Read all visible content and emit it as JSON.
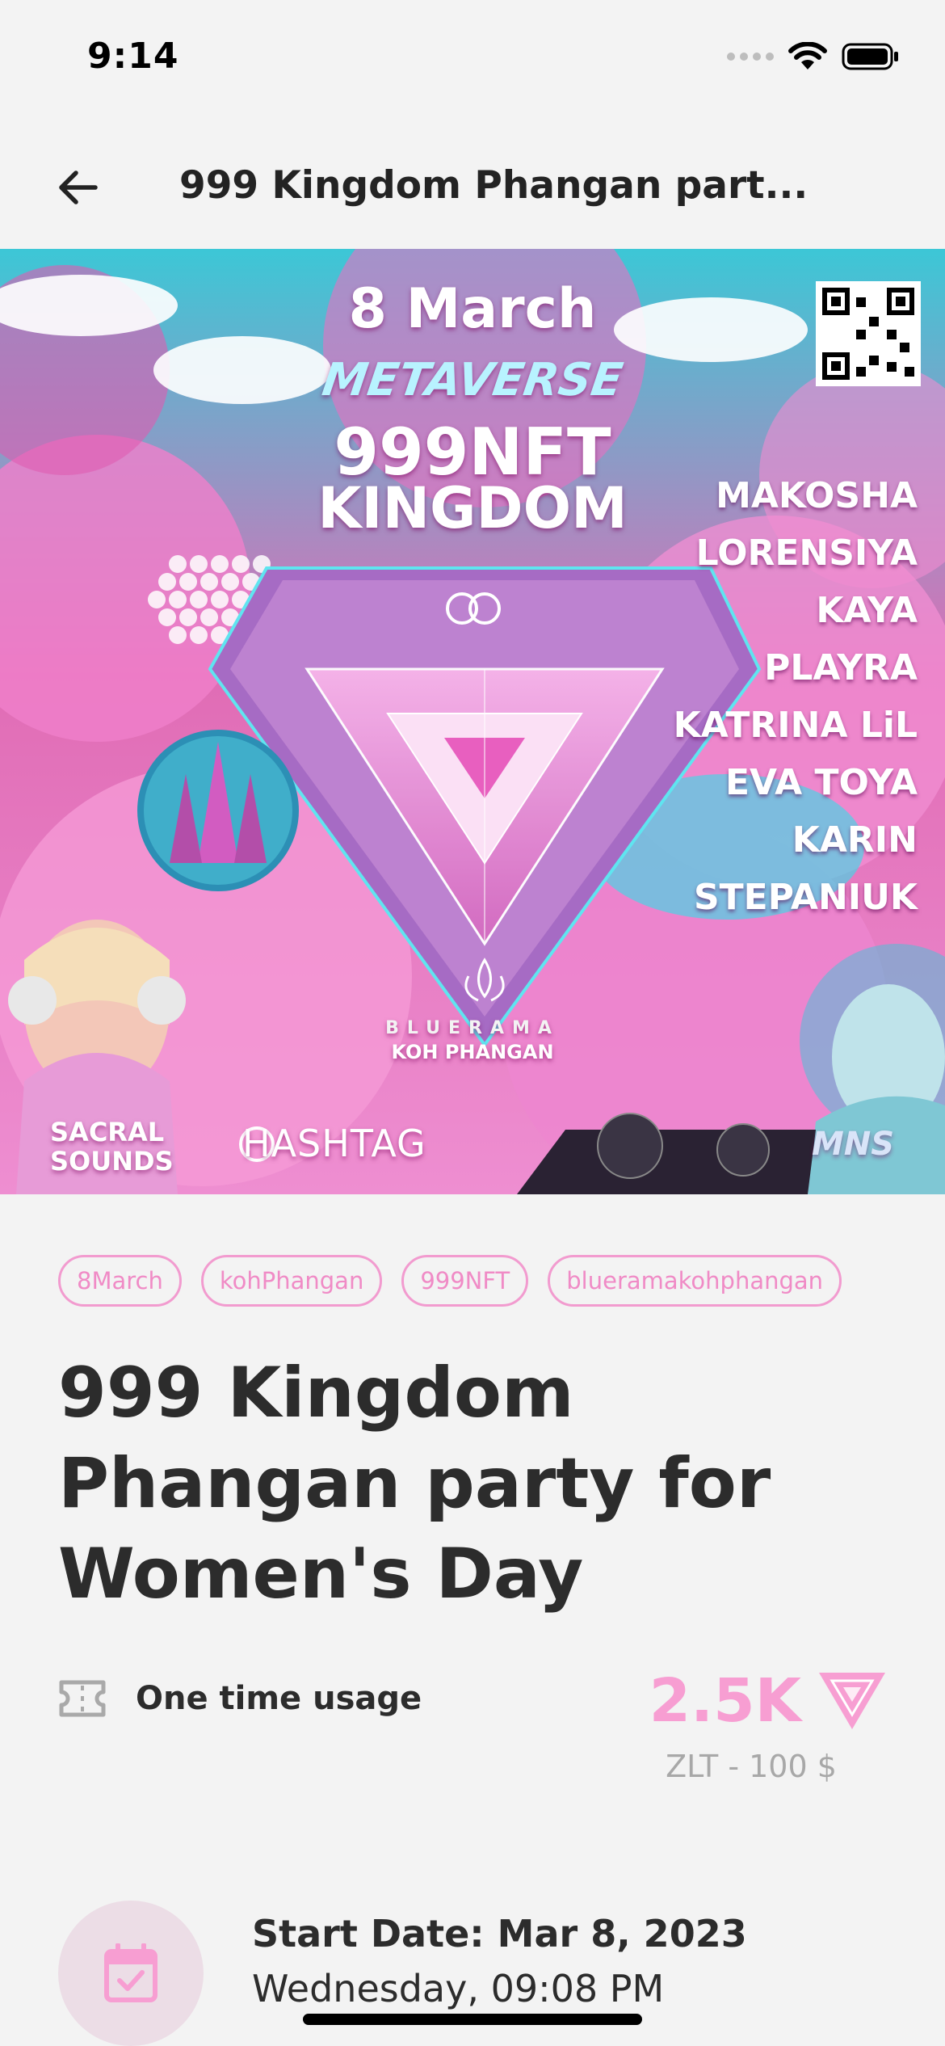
{
  "status_bar": {
    "time": "9:14"
  },
  "header": {
    "title": "999 Kingdom Phangan part..."
  },
  "poster": {
    "date": "8 March",
    "subtitle": "METAVERSE",
    "title_line1": "999NFT",
    "title_line2": "KINGDOM",
    "lineup": [
      "MAKOSHA",
      "LORENSIYA",
      "KAYA",
      "PLAYRA",
      "KATRINA LiL",
      "EVA TOYA",
      "KARIN",
      "STEPANIUK"
    ],
    "brand": "BLUERAMA",
    "location": "KOH PHANGAN",
    "sponsor_left": "SACRAL SOUNDS",
    "sponsor_center": "HASHTAG",
    "sponsor_right": "MNS",
    "colors": {
      "pink": "#e06cb5",
      "cyan": "#3cc7d6"
    }
  },
  "tags": [
    "8March",
    "kohPhangan",
    "999NFT",
    "blueramakohphangan"
  ],
  "event": {
    "title": "999 Kingdom Phangan party for Women's Day",
    "usage_label": "One time usage",
    "usage_icon": "ticket-icon",
    "price_value": "2.5K",
    "price_icon": "zlt-token-icon",
    "price_sub": "ZLT - 100 $",
    "start_date_label": "Start Date: Mar 8, 2023",
    "start_date_sub": "Wednesday, 09:08 PM",
    "date_icon": "calendar-check-icon"
  },
  "colors": {
    "accent": "#f79ed2",
    "background": "#f3f3f3",
    "text": "#2c2c2c"
  }
}
